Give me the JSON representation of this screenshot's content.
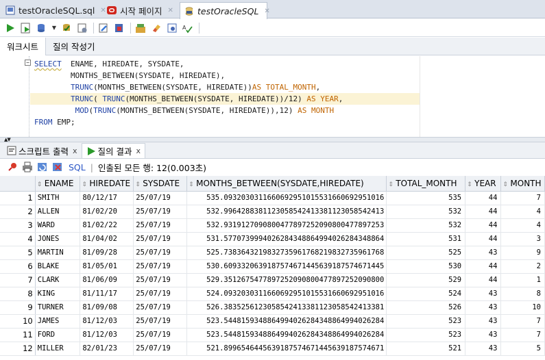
{
  "doc_tabs": [
    {
      "label": "testOracleSQL.sql",
      "icon": "sql-file-icon"
    },
    {
      "label": "시작 페이지",
      "icon": "oracle-start-icon"
    },
    {
      "label": "testOracleSQL",
      "icon": "sql-connection-icon"
    }
  ],
  "worksheet_tabs": [
    "워크시트",
    "질의 작성기"
  ],
  "sql_lines": [
    {
      "parts": [
        [
          "kw sq",
          "SELECT"
        ],
        [
          "",
          "  ENAME, HIREDATE, SYSDATE,"
        ]
      ]
    },
    {
      "parts": [
        [
          "",
          "        MONTHS_BETWEEN(SYSDATE, HIREDATE),"
        ]
      ]
    },
    {
      "parts": [
        [
          "kw",
          "        TRUNC"
        ],
        [
          "",
          "(MONTHS_BETWEEN(SYSDATE, HIREDATE))"
        ],
        [
          "kw-o",
          "AS TOTAL_MONTH"
        ],
        [
          "",
          ","
        ]
      ]
    },
    {
      "parts": [
        [
          "kw",
          "        TRUNC"
        ],
        [
          "",
          "( "
        ],
        [
          "kw",
          "TRUNC"
        ],
        [
          "",
          "(MONTHS_BETWEEN(SYSDATE, HIREDATE))/12) "
        ],
        [
          "kw-o",
          "AS YEAR"
        ],
        [
          "",
          ","
        ]
      ]
    },
    {
      "parts": [
        [
          "kw",
          "         MOD"
        ],
        [
          "",
          "("
        ],
        [
          "kw",
          "TRUNC"
        ],
        [
          "",
          "(MONTHS_BETWEEN(SYSDATE, HIREDATE)),12) "
        ],
        [
          "kw-o",
          "AS MONTH"
        ]
      ]
    },
    {
      "parts": [
        [
          "kw",
          "FROM"
        ],
        [
          "",
          " EMP;"
        ]
      ]
    }
  ],
  "result_tabs": [
    "스크립트 출력",
    "질의 결과"
  ],
  "result_toolbar": {
    "sql_label": "SQL",
    "status": "인출된 모든 행: 12(0.003초)"
  },
  "columns": [
    "ENAME",
    "HIREDATE",
    "SYSDATE",
    "MONTHS_BETWEEN(SYSDATE,HIREDATE)",
    "TOTAL_MONTH",
    "YEAR",
    "MONTH"
  ],
  "rows": [
    {
      "n": "1",
      "ename": "SMITH",
      "hiredate": "80/12/17",
      "sysdate": "25/07/19",
      "mb": "535.0932030311660692951015531660692951016",
      "total": "535",
      "year": "44",
      "month": "7"
    },
    {
      "n": "2",
      "ename": "ALLEN",
      "hiredate": "81/02/20",
      "sysdate": "25/07/19",
      "mb": "532.9964288381123058542413381123058542413",
      "total": "532",
      "year": "44",
      "month": "4"
    },
    {
      "n": "3",
      "ename": "WARD",
      "hiredate": "81/02/22",
      "sysdate": "25/07/19",
      "mb": "532.9319127090800477897252090800477897253",
      "total": "532",
      "year": "44",
      "month": "4"
    },
    {
      "n": "4",
      "ename": "JONES",
      "hiredate": "81/04/02",
      "sysdate": "25/07/19",
      "mb": "531.5770739994026284348864994026284348864",
      "total": "531",
      "year": "44",
      "month": "3"
    },
    {
      "n": "5",
      "ename": "MARTIN",
      "hiredate": "81/09/28",
      "sysdate": "25/07/19",
      "mb": "525.7383643219832735961768219832735961768",
      "total": "525",
      "year": "43",
      "month": "9"
    },
    {
      "n": "6",
      "ename": "BLAKE",
      "hiredate": "81/05/01",
      "sysdate": "25/07/19",
      "mb": "530.6093320639187574671445639187574671445",
      "total": "530",
      "year": "44",
      "month": "2"
    },
    {
      "n": "7",
      "ename": "CLARK",
      "hiredate": "81/06/09",
      "sysdate": "25/07/19",
      "mb": "529.3512675477897252090800477897252090800",
      "total": "529",
      "year": "44",
      "month": "1"
    },
    {
      "n": "8",
      "ename": "KING",
      "hiredate": "81/11/17",
      "sysdate": "25/07/19",
      "mb": "524.0932030311660692951015531660692951016",
      "total": "524",
      "year": "43",
      "month": "8"
    },
    {
      "n": "9",
      "ename": "TURNER",
      "hiredate": "81/09/08",
      "sysdate": "25/07/19",
      "mb": "526.3835256123058542413381123058542413381",
      "total": "526",
      "year": "43",
      "month": "10"
    },
    {
      "n": "10",
      "ename": "JAMES",
      "hiredate": "81/12/03",
      "sysdate": "25/07/19",
      "mb": "523.5448159348864994026284348864994026284",
      "total": "523",
      "year": "43",
      "month": "7"
    },
    {
      "n": "11",
      "ename": "FORD",
      "hiredate": "81/12/03",
      "sysdate": "25/07/19",
      "mb": "523.5448159348864994026284348864994026284",
      "total": "523",
      "year": "43",
      "month": "7"
    },
    {
      "n": "12",
      "ename": "MILLER",
      "hiredate": "82/01/23",
      "sysdate": "25/07/19",
      "mb": "521.8996546445639187574671445639187574671",
      "total": "521",
      "year": "43",
      "month": "5"
    }
  ]
}
